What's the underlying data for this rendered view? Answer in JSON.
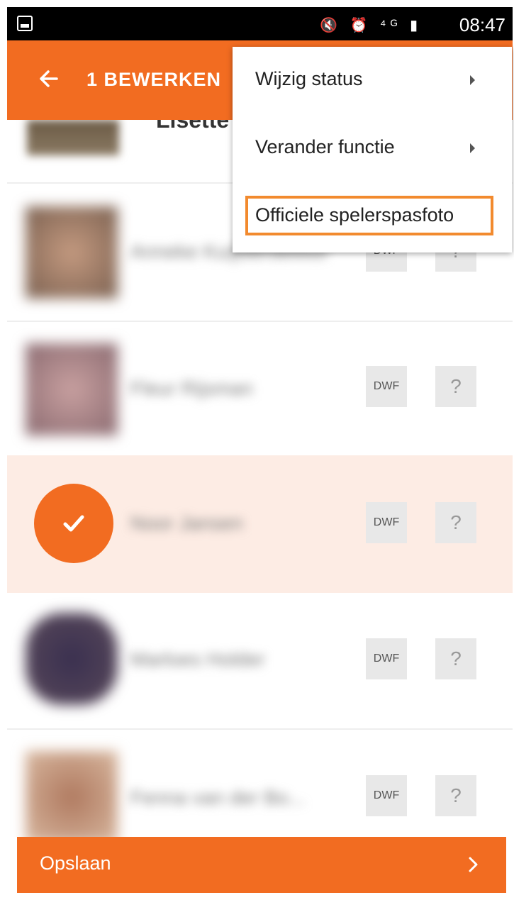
{
  "status_bar": {
    "time": "08:47",
    "icons": "🔇 ⏰ ⁴ᴳ ▮"
  },
  "app_bar": {
    "title": "1 BEWERKEN"
  },
  "list": {
    "top_partial_name": "Lisette",
    "rows": [
      {
        "name": "Anneke Kuijsterdekker",
        "tag": "DWF",
        "status": "?"
      },
      {
        "name": "Fleur Rijsman",
        "tag": "DWF",
        "status": "?"
      },
      {
        "name": "Noor Jansen",
        "tag": "DWF",
        "status": "?",
        "selected": true
      },
      {
        "name": "Marloes Holder",
        "tag": "DWF",
        "status": "?"
      },
      {
        "name": "Fenna van der Bo...",
        "tag": "DWF",
        "status": "?"
      }
    ]
  },
  "menu": {
    "items": [
      {
        "label": "Wijzig status"
      },
      {
        "label": "Verander functie"
      },
      {
        "label": "Officiele spelerspasfoto"
      }
    ]
  },
  "save_bar": {
    "label": "Opslaan",
    "chevron": "›"
  },
  "colors": {
    "accent": "#f26c21",
    "selected_row": "#fdece4",
    "highlight": "#f28a2e"
  }
}
